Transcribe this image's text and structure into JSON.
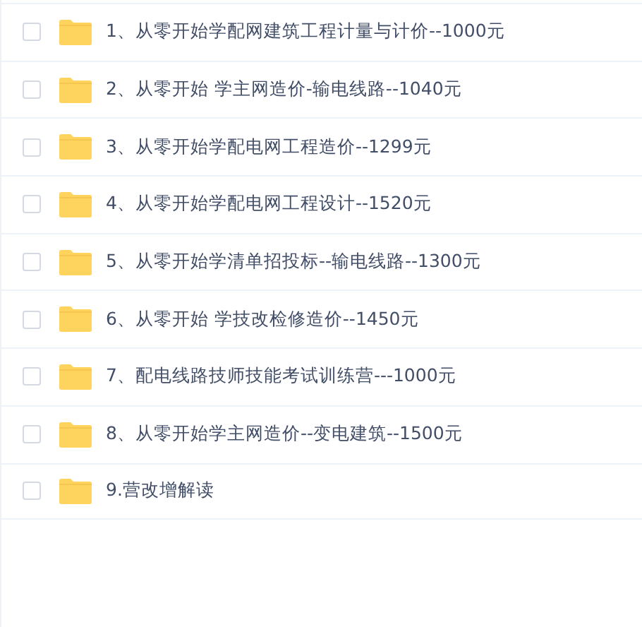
{
  "files": [
    {
      "name": "1、从零开始学配网建筑工程计量与计价--1000元",
      "checked": false
    },
    {
      "name": "2、从零开始 学主网造价-输电线路--1040元",
      "checked": false
    },
    {
      "name": "3、从零开始学配电网工程造价--1299元",
      "checked": false
    },
    {
      "name": "4、从零开始学配电网工程设计--1520元",
      "checked": false
    },
    {
      "name": "5、从零开始学清单招投标--输电线路--1300元",
      "checked": false
    },
    {
      "name": "6、从零开始 学技改检修造价--1450元",
      "checked": false
    },
    {
      "name": "7、配电线路技师技能考试训练营---1000元",
      "checked": false
    },
    {
      "name": "8、从零开始学主网造价--变电建筑--1500元",
      "checked": false
    },
    {
      "name": "9.营改增解读",
      "checked": false
    }
  ]
}
